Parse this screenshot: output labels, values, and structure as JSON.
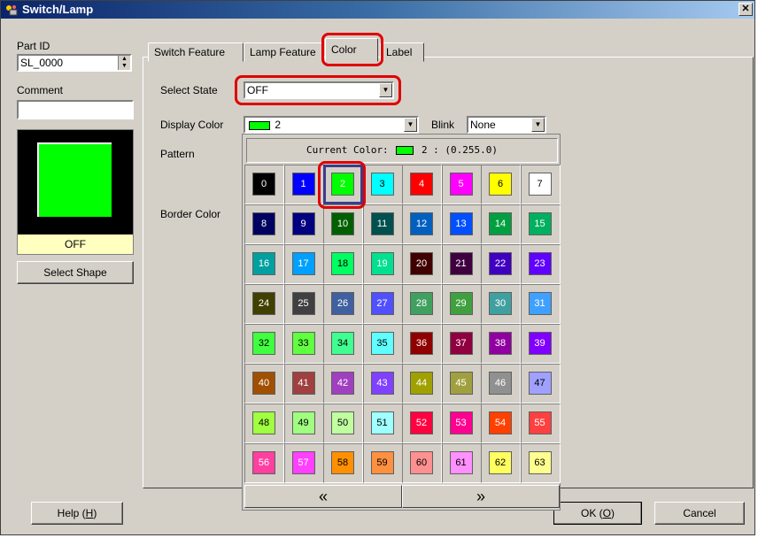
{
  "window": {
    "title": "Switch/Lamp",
    "close_label": "✕"
  },
  "left": {
    "part_id_label": "Part ID",
    "part_id_value": "SL_0000",
    "comment_label": "Comment",
    "comment_value": "",
    "preview_state": "OFF",
    "select_shape_label": "Select Shape"
  },
  "tabs": [
    {
      "label": "Switch Feature"
    },
    {
      "label": "Lamp Feature"
    },
    {
      "label": "Color"
    },
    {
      "label": "Label"
    }
  ],
  "form": {
    "select_state_label": "Select State",
    "select_state_value": "OFF",
    "display_color_label": "Display Color",
    "display_color_value": "2",
    "blink_label": "Blink",
    "blink_value": "None",
    "pattern_label": "Pattern",
    "border_color_label": "Border Color"
  },
  "palette": {
    "current_label": "Current Color:",
    "current_value": "2 : (0.255.0)",
    "selected": 2,
    "prev_label": "«",
    "next_label": "»",
    "colors": [
      "#000000",
      "#0000ff",
      "#00ff00",
      "#00ffff",
      "#ff0000",
      "#ff00ff",
      "#ffff00",
      "#ffffff",
      "#000060",
      "#000080",
      "#006000",
      "#005050",
      "#0060c0",
      "#0050ff",
      "#00a040",
      "#00b060",
      "#00a0a0",
      "#00a0ff",
      "#00ff60",
      "#00e090",
      "#400000",
      "#400040",
      "#4000c0",
      "#6000ff",
      "#404000",
      "#404040",
      "#4060a0",
      "#5050ff",
      "#40a060",
      "#40a040",
      "#40a0a0",
      "#40a0ff",
      "#40ff40",
      "#60ff40",
      "#40ff90",
      "#60ffff",
      "#900000",
      "#900040",
      "#9000a0",
      "#8000ff",
      "#a05000",
      "#a04040",
      "#a040c0",
      "#8040ff",
      "#a0a000",
      "#a0a040",
      "#909090",
      "#a0a0ff",
      "#a0ff40",
      "#a0ff80",
      "#c0ffa0",
      "#a0ffff",
      "#ff0040",
      "#ff0090",
      "#ff4000",
      "#ff4040",
      "#ff40a0",
      "#ff40ff",
      "#ff9000",
      "#ff9040",
      "#ff9090",
      "#ff90ff",
      "#ffff60",
      "#ffff90"
    ]
  }
}
